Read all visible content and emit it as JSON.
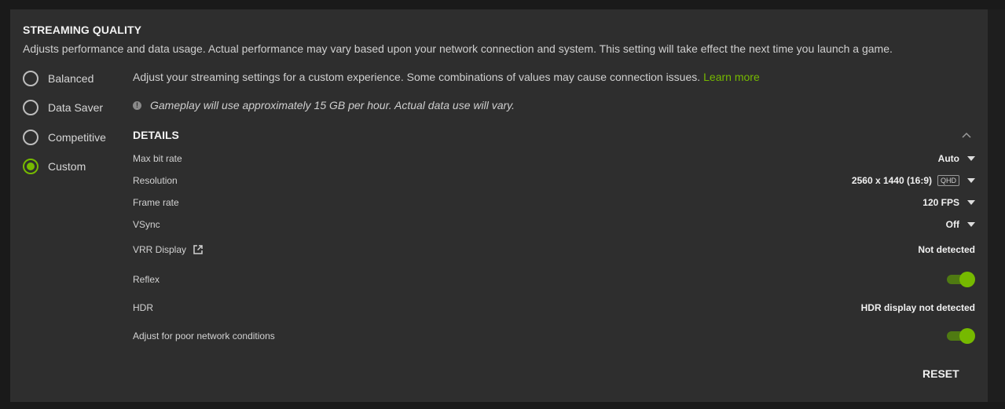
{
  "section": {
    "title": "STREAMING QUALITY",
    "subtitle": "Adjusts performance and data usage. Actual performance may vary based upon your network connection and system. This setting will take effect the next time you launch a game."
  },
  "modes": [
    {
      "label": "Balanced",
      "selected": false
    },
    {
      "label": "Data Saver",
      "selected": false
    },
    {
      "label": "Competitive",
      "selected": false
    },
    {
      "label": "Custom",
      "selected": true
    }
  ],
  "custom": {
    "description": "Adjust your streaming settings for a custom experience. Some combinations of values may cause connection issues.",
    "learn_more": "Learn more",
    "notice": "Gameplay will use approximately 15 GB per hour. Actual data use will vary."
  },
  "details": {
    "heading": "DETAILS",
    "max_bit_rate": {
      "label": "Max bit rate",
      "value": "Auto"
    },
    "resolution": {
      "label": "Resolution",
      "value": "2560 x 1440 (16:9)",
      "badge": "QHD"
    },
    "frame_rate": {
      "label": "Frame rate",
      "value": "120 FPS"
    },
    "vsync": {
      "label": "VSync",
      "value": "Off"
    },
    "vrr": {
      "label": "VRR Display",
      "value": "Not detected"
    },
    "reflex": {
      "label": "Reflex",
      "enabled": true
    },
    "hdr": {
      "label": "HDR",
      "value": "HDR display not detected"
    },
    "poor_network": {
      "label": "Adjust for poor network conditions",
      "enabled": true
    }
  },
  "reset_label": "RESET",
  "colors": {
    "accent": "#76b900",
    "panel": "#2e2e2e",
    "background": "#1a1a1a"
  },
  "icons": {
    "info": "info-icon",
    "external": "external-link-icon",
    "collapse": "chevron-up-icon",
    "dropdown": "caret-down-icon"
  }
}
